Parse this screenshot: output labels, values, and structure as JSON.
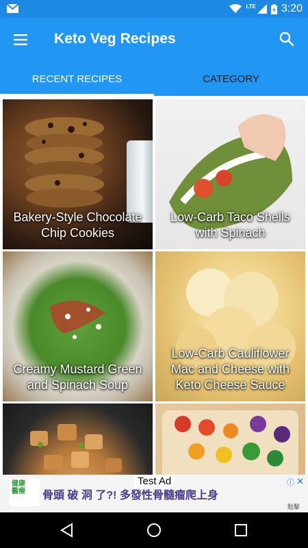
{
  "status_bar": {
    "time": "3:20",
    "network": "LTE",
    "icons": [
      "gmail-icon",
      "wifi-icon",
      "signal-icon",
      "battery-icon"
    ]
  },
  "app_bar": {
    "title": "Keto Veg Recipes",
    "icons": [
      "menu-icon",
      "search-icon"
    ]
  },
  "tabs": [
    {
      "label": "RECENT RECIPES",
      "active": true
    },
    {
      "label": "CATEGORY",
      "active": false
    }
  ],
  "recipes": [
    {
      "title": "Bakery-Style Chocolate Chip Cookies"
    },
    {
      "title": "Low-Carb Taco Shells with Spinach"
    },
    {
      "title": "Creamy Mustard Green and Spinach Soup"
    },
    {
      "title": "Low-Carb Cauliflower Mac and Cheese with Keto Cheese Sauce"
    },
    {
      "title": ""
    },
    {
      "title": ""
    }
  ],
  "ad": {
    "badge": "Test Ad",
    "logo_text": "健康\n醫療",
    "headline": "骨頭 破 洞 了?! 多發性骨髓瘤爬上身",
    "cta": "點擊",
    "info_icon": "info-icon",
    "close_icon": "close-icon"
  },
  "colors": {
    "primary": "#2196F3",
    "status_bar": "#1E88E5",
    "tab_indicator": "#FFFFFF"
  },
  "nav_bar": {
    "icons": [
      "back-icon",
      "home-icon",
      "recents-icon"
    ]
  }
}
